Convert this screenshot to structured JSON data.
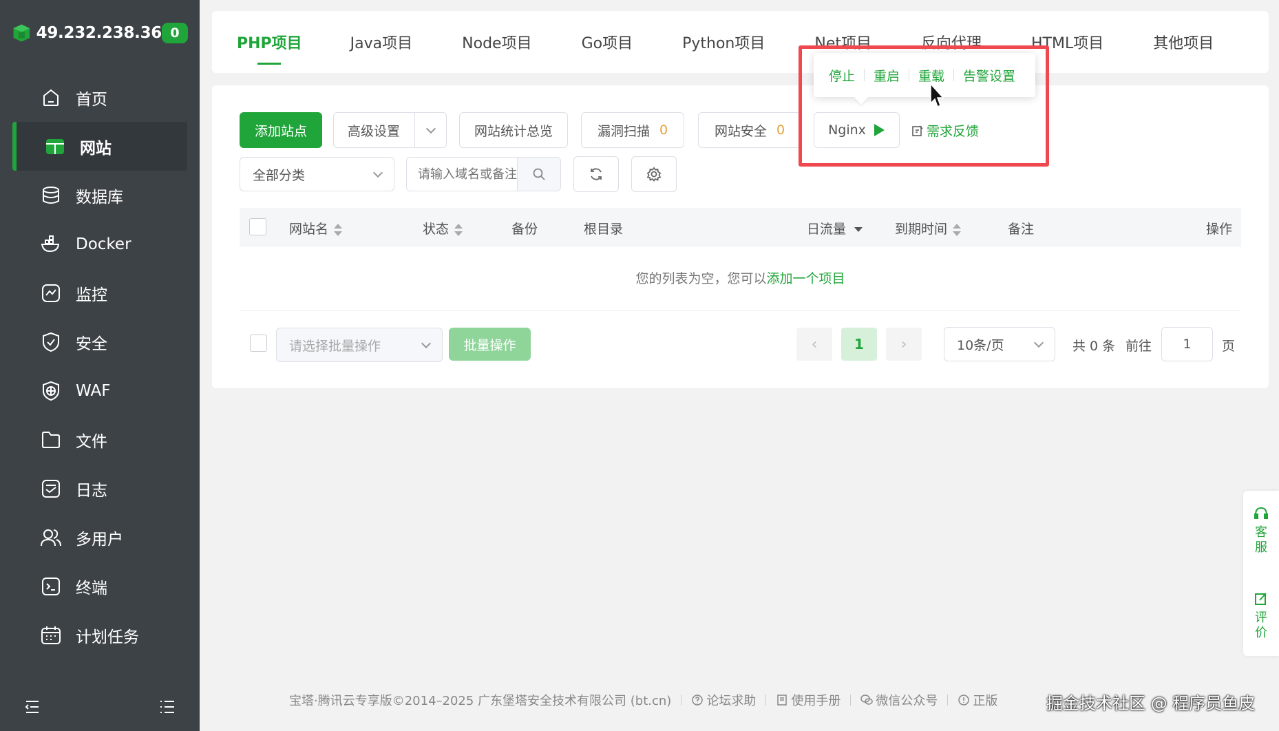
{
  "server": {
    "ip": "49.232.238.36",
    "badge": "0"
  },
  "nav": [
    {
      "label": "首页",
      "icon": "home-icon"
    },
    {
      "label": "网站",
      "icon": "website-icon"
    },
    {
      "label": "数据库",
      "icon": "database-icon"
    },
    {
      "label": "Docker",
      "icon": "docker-icon"
    },
    {
      "label": "监控",
      "icon": "monitor-icon"
    },
    {
      "label": "安全",
      "icon": "shield-icon"
    },
    {
      "label": "WAF",
      "icon": "waf-icon"
    },
    {
      "label": "文件",
      "icon": "folder-icon"
    },
    {
      "label": "日志",
      "icon": "log-icon"
    },
    {
      "label": "多用户",
      "icon": "users-icon"
    },
    {
      "label": "终端",
      "icon": "terminal-icon"
    },
    {
      "label": "计划任务",
      "icon": "calendar-icon"
    }
  ],
  "tabs": [
    "PHP项目",
    "Java项目",
    "Node项目",
    "Go项目",
    "Python项目",
    "Net项目",
    "反向代理",
    "HTML项目",
    "其他项目"
  ],
  "toolbar": {
    "add_site": "添加站点",
    "advanced": "高级设置",
    "stats": "网站统计总览",
    "vuln_scan": "漏洞扫描",
    "vuln_count": "0",
    "site_security": "网站安全",
    "security_count": "0",
    "nginx": "Nginx",
    "feedback": "需求反馈"
  },
  "popup": {
    "stop": "停止",
    "restart": "重启",
    "reload": "重载",
    "alert": "告警设置"
  },
  "filter": {
    "category": "全部分类",
    "search_placeholder": "请输入域名或备注"
  },
  "table": {
    "cols": {
      "name": "网站名",
      "status": "状态",
      "backup": "备份",
      "root": "根目录",
      "traffic": "日流量",
      "expire": "到期时间",
      "remark": "备注",
      "ops": "操作"
    },
    "empty_prefix": "您的列表为空，您可以",
    "empty_link": "添加一个项目"
  },
  "batch": {
    "placeholder": "请选择批量操作",
    "button": "批量操作"
  },
  "pager": {
    "current": "1",
    "size": "10条/页",
    "total": "共 0 条",
    "goto_label": "前往",
    "goto_value": "1",
    "page_unit": "页"
  },
  "float": {
    "service": "客服",
    "rate": "评价"
  },
  "footer": {
    "copyright": "宝塔·腾讯云专享版©2014–2025 广东堡塔安全技术有限公司 (bt.cn)",
    "forum": "论坛求助",
    "manual": "使用手册",
    "wechat": "微信公众号",
    "genuine": "正版"
  },
  "watermark": "掘金技术社区 @ 程序员鱼皮",
  "colors": {
    "accent": "#20a53a",
    "sidebar": "#3d4246",
    "highlight": "#f0484f"
  }
}
